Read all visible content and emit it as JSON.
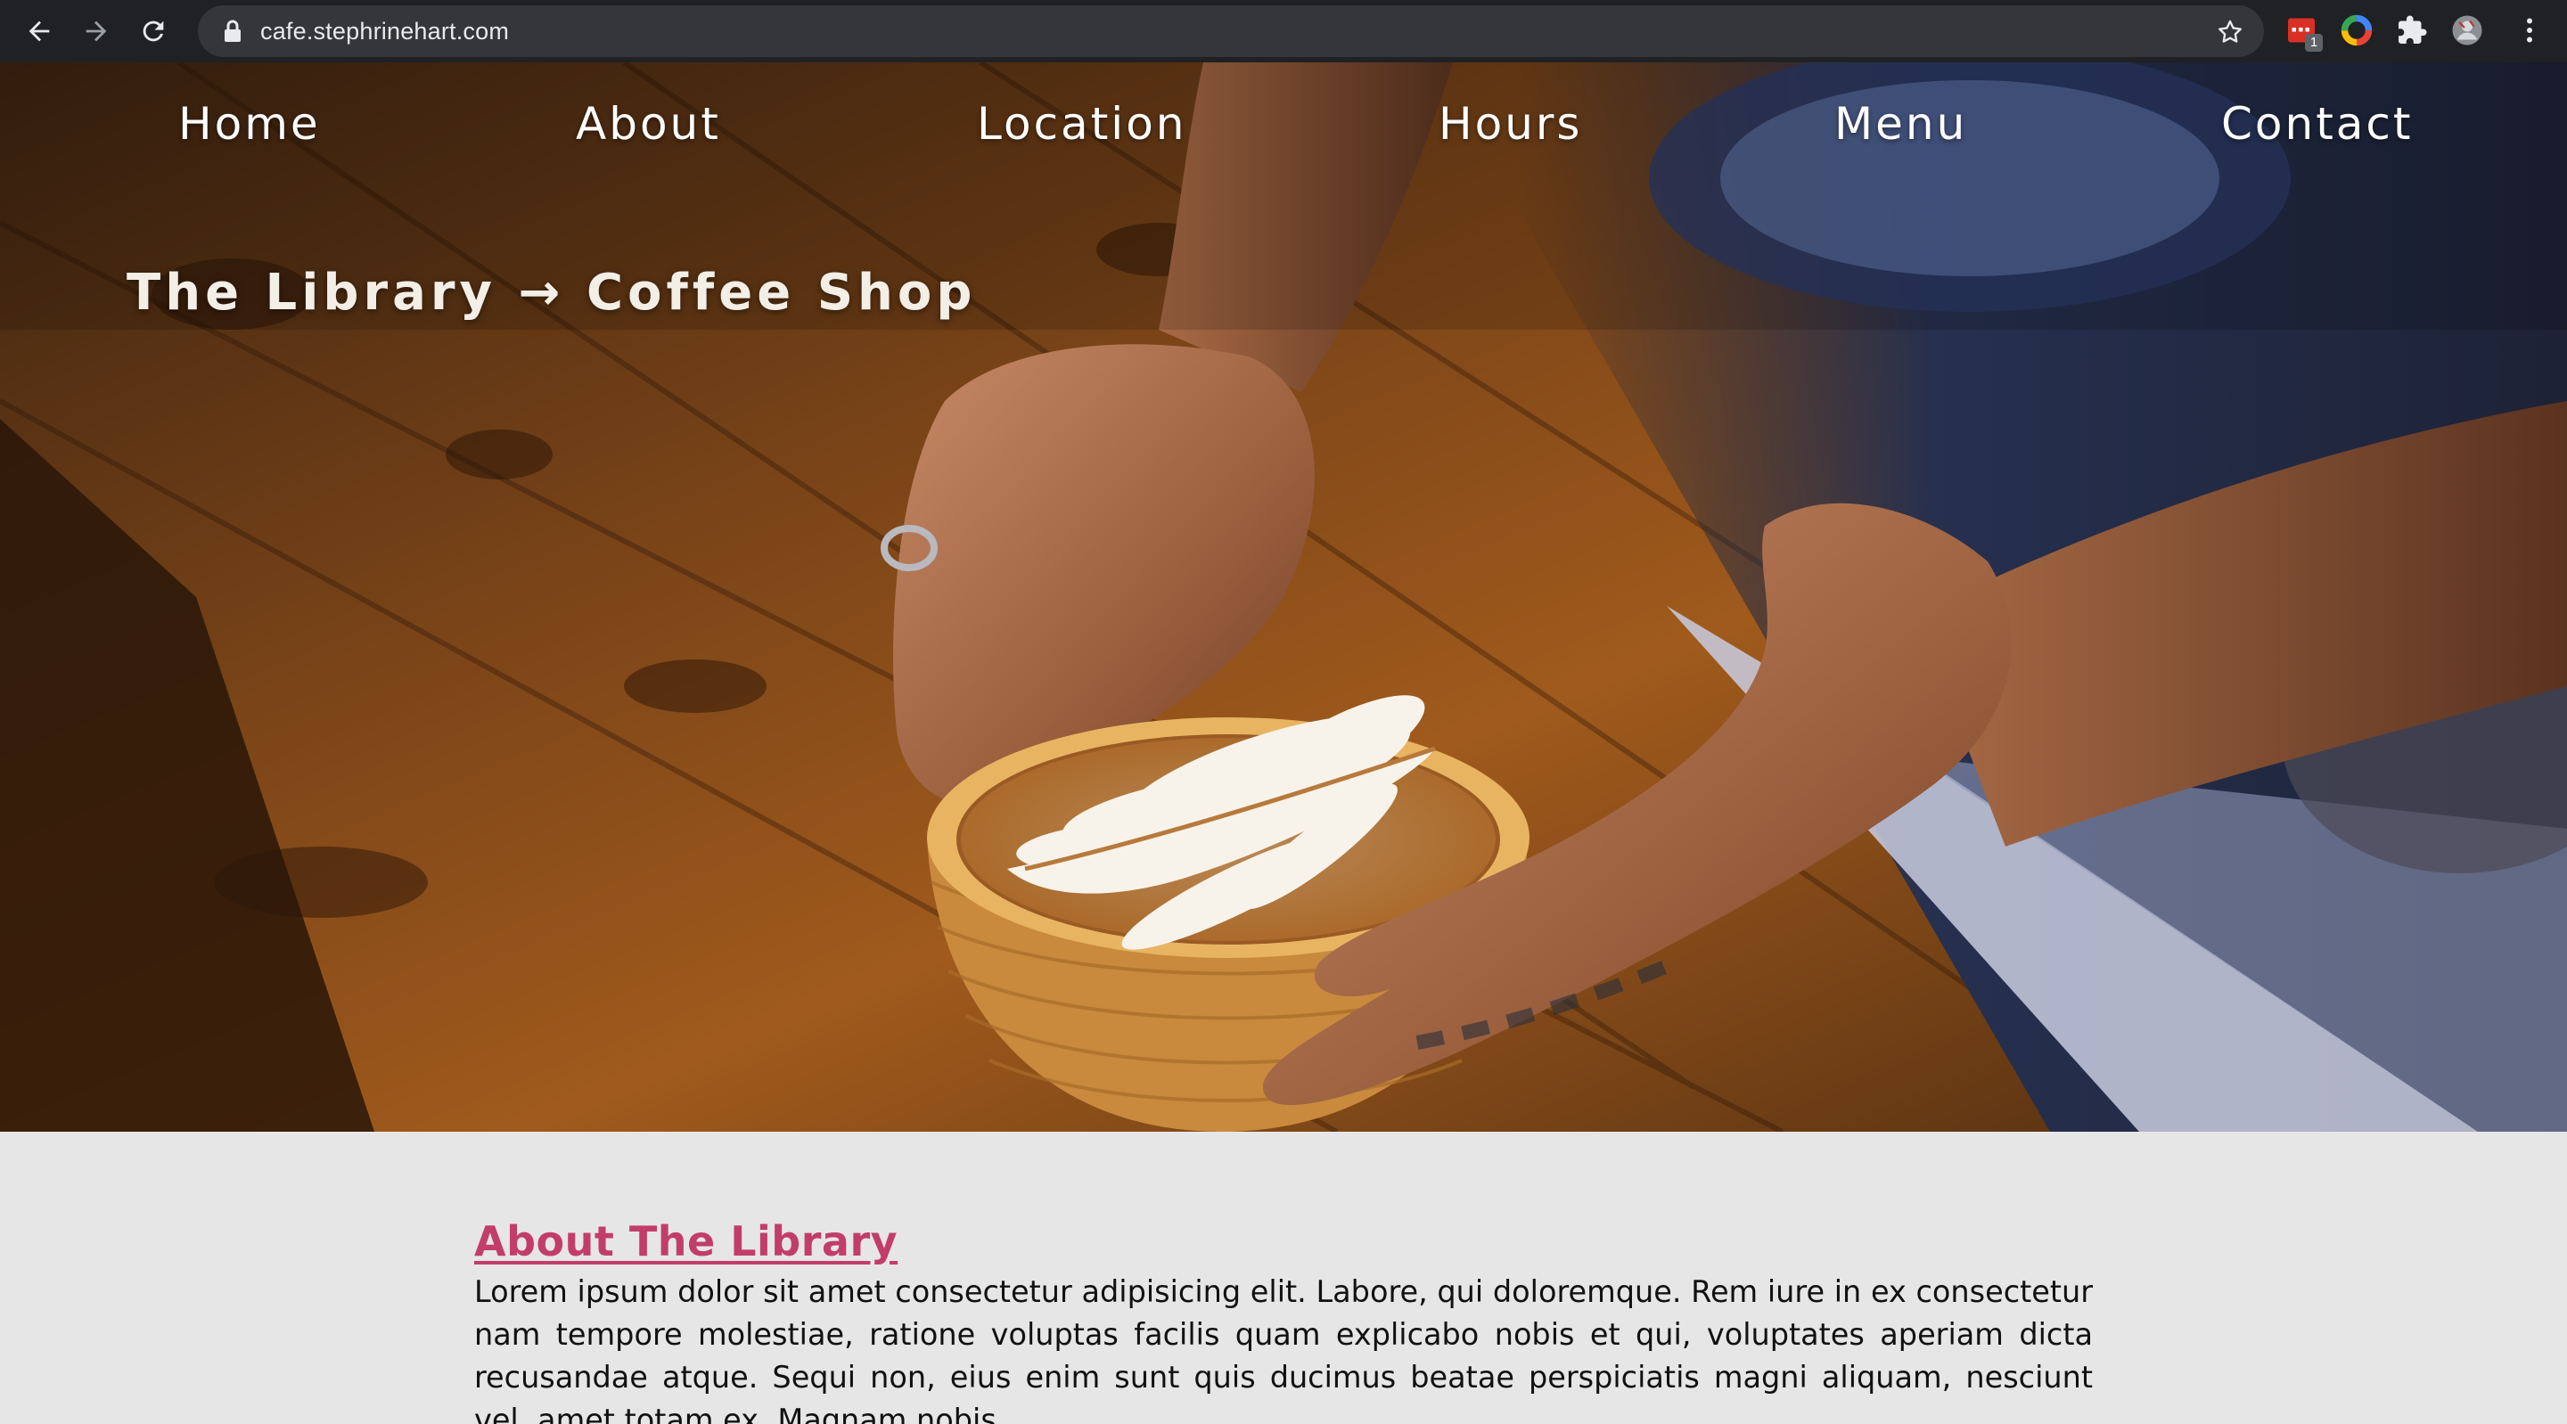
{
  "browser": {
    "url": "cafe.stephrinehart.com",
    "extension_badge": "1"
  },
  "nav": {
    "home": "Home",
    "about": "About",
    "location": "Location",
    "hours": "Hours",
    "menu": "Menu",
    "contact": "Contact"
  },
  "hero": {
    "title": "The Library → Coffee Shop"
  },
  "about": {
    "heading": "About The Library",
    "body": "Lorem ipsum dolor sit amet consectetur adipisicing elit. Labore, qui doloremque. Rem iure in ex consectetur nam tempore molestiae, ratione voluptas facilis quam explicabo nobis et qui, voluptates aperiam dicta recusandae atque. Sequi non, eius enim sunt quis ducimus beatae perspiciatis magni aliquam, nesciunt vel, amet totam ex. Magnam nobis"
  },
  "colors": {
    "chrome_bg": "#202124",
    "omnibox_bg": "#35363a",
    "heading_accent": "#c23d6a",
    "content_bg": "#e6e6e6"
  },
  "icons": [
    "back-arrow-icon",
    "forward-arrow-icon",
    "reload-icon",
    "lock-icon",
    "star-icon",
    "calendar-extension-icon",
    "color-wheel-icon",
    "puzzle-icon",
    "profile-avatar-icon",
    "more-vert-icon"
  ]
}
